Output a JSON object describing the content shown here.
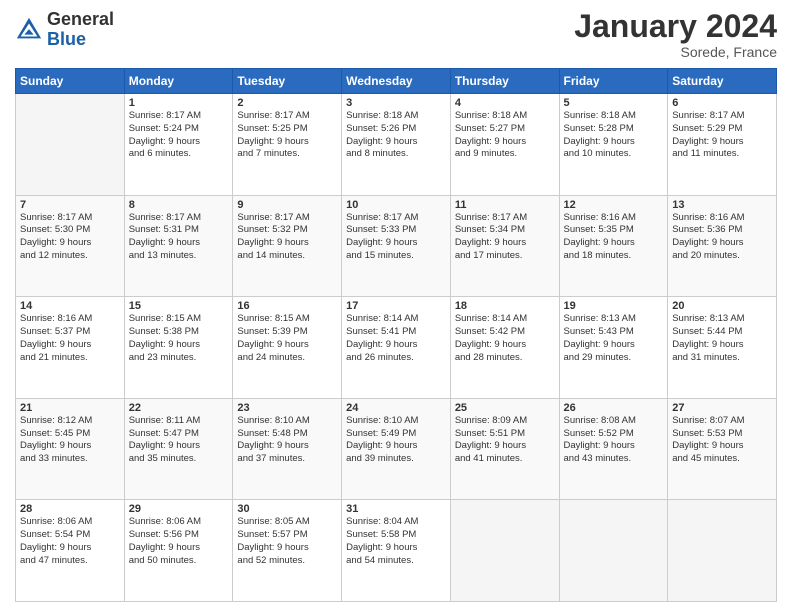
{
  "header": {
    "logo_general": "General",
    "logo_blue": "Blue",
    "month": "January 2024",
    "location": "Sorede, France"
  },
  "days_of_week": [
    "Sunday",
    "Monday",
    "Tuesday",
    "Wednesday",
    "Thursday",
    "Friday",
    "Saturday"
  ],
  "weeks": [
    [
      {
        "day": "",
        "info": ""
      },
      {
        "day": "1",
        "info": "Sunrise: 8:17 AM\nSunset: 5:24 PM\nDaylight: 9 hours\nand 6 minutes."
      },
      {
        "day": "2",
        "info": "Sunrise: 8:17 AM\nSunset: 5:25 PM\nDaylight: 9 hours\nand 7 minutes."
      },
      {
        "day": "3",
        "info": "Sunrise: 8:18 AM\nSunset: 5:26 PM\nDaylight: 9 hours\nand 8 minutes."
      },
      {
        "day": "4",
        "info": "Sunrise: 8:18 AM\nSunset: 5:27 PM\nDaylight: 9 hours\nand 9 minutes."
      },
      {
        "day": "5",
        "info": "Sunrise: 8:18 AM\nSunset: 5:28 PM\nDaylight: 9 hours\nand 10 minutes."
      },
      {
        "day": "6",
        "info": "Sunrise: 8:17 AM\nSunset: 5:29 PM\nDaylight: 9 hours\nand 11 minutes."
      }
    ],
    [
      {
        "day": "7",
        "info": "Sunrise: 8:17 AM\nSunset: 5:30 PM\nDaylight: 9 hours\nand 12 minutes."
      },
      {
        "day": "8",
        "info": "Sunrise: 8:17 AM\nSunset: 5:31 PM\nDaylight: 9 hours\nand 13 minutes."
      },
      {
        "day": "9",
        "info": "Sunrise: 8:17 AM\nSunset: 5:32 PM\nDaylight: 9 hours\nand 14 minutes."
      },
      {
        "day": "10",
        "info": "Sunrise: 8:17 AM\nSunset: 5:33 PM\nDaylight: 9 hours\nand 15 minutes."
      },
      {
        "day": "11",
        "info": "Sunrise: 8:17 AM\nSunset: 5:34 PM\nDaylight: 9 hours\nand 17 minutes."
      },
      {
        "day": "12",
        "info": "Sunrise: 8:16 AM\nSunset: 5:35 PM\nDaylight: 9 hours\nand 18 minutes."
      },
      {
        "day": "13",
        "info": "Sunrise: 8:16 AM\nSunset: 5:36 PM\nDaylight: 9 hours\nand 20 minutes."
      }
    ],
    [
      {
        "day": "14",
        "info": "Sunrise: 8:16 AM\nSunset: 5:37 PM\nDaylight: 9 hours\nand 21 minutes."
      },
      {
        "day": "15",
        "info": "Sunrise: 8:15 AM\nSunset: 5:38 PM\nDaylight: 9 hours\nand 23 minutes."
      },
      {
        "day": "16",
        "info": "Sunrise: 8:15 AM\nSunset: 5:39 PM\nDaylight: 9 hours\nand 24 minutes."
      },
      {
        "day": "17",
        "info": "Sunrise: 8:14 AM\nSunset: 5:41 PM\nDaylight: 9 hours\nand 26 minutes."
      },
      {
        "day": "18",
        "info": "Sunrise: 8:14 AM\nSunset: 5:42 PM\nDaylight: 9 hours\nand 28 minutes."
      },
      {
        "day": "19",
        "info": "Sunrise: 8:13 AM\nSunset: 5:43 PM\nDaylight: 9 hours\nand 29 minutes."
      },
      {
        "day": "20",
        "info": "Sunrise: 8:13 AM\nSunset: 5:44 PM\nDaylight: 9 hours\nand 31 minutes."
      }
    ],
    [
      {
        "day": "21",
        "info": "Sunrise: 8:12 AM\nSunset: 5:45 PM\nDaylight: 9 hours\nand 33 minutes."
      },
      {
        "day": "22",
        "info": "Sunrise: 8:11 AM\nSunset: 5:47 PM\nDaylight: 9 hours\nand 35 minutes."
      },
      {
        "day": "23",
        "info": "Sunrise: 8:10 AM\nSunset: 5:48 PM\nDaylight: 9 hours\nand 37 minutes."
      },
      {
        "day": "24",
        "info": "Sunrise: 8:10 AM\nSunset: 5:49 PM\nDaylight: 9 hours\nand 39 minutes."
      },
      {
        "day": "25",
        "info": "Sunrise: 8:09 AM\nSunset: 5:51 PM\nDaylight: 9 hours\nand 41 minutes."
      },
      {
        "day": "26",
        "info": "Sunrise: 8:08 AM\nSunset: 5:52 PM\nDaylight: 9 hours\nand 43 minutes."
      },
      {
        "day": "27",
        "info": "Sunrise: 8:07 AM\nSunset: 5:53 PM\nDaylight: 9 hours\nand 45 minutes."
      }
    ],
    [
      {
        "day": "28",
        "info": "Sunrise: 8:06 AM\nSunset: 5:54 PM\nDaylight: 9 hours\nand 47 minutes."
      },
      {
        "day": "29",
        "info": "Sunrise: 8:06 AM\nSunset: 5:56 PM\nDaylight: 9 hours\nand 50 minutes."
      },
      {
        "day": "30",
        "info": "Sunrise: 8:05 AM\nSunset: 5:57 PM\nDaylight: 9 hours\nand 52 minutes."
      },
      {
        "day": "31",
        "info": "Sunrise: 8:04 AM\nSunset: 5:58 PM\nDaylight: 9 hours\nand 54 minutes."
      },
      {
        "day": "",
        "info": ""
      },
      {
        "day": "",
        "info": ""
      },
      {
        "day": "",
        "info": ""
      }
    ]
  ]
}
